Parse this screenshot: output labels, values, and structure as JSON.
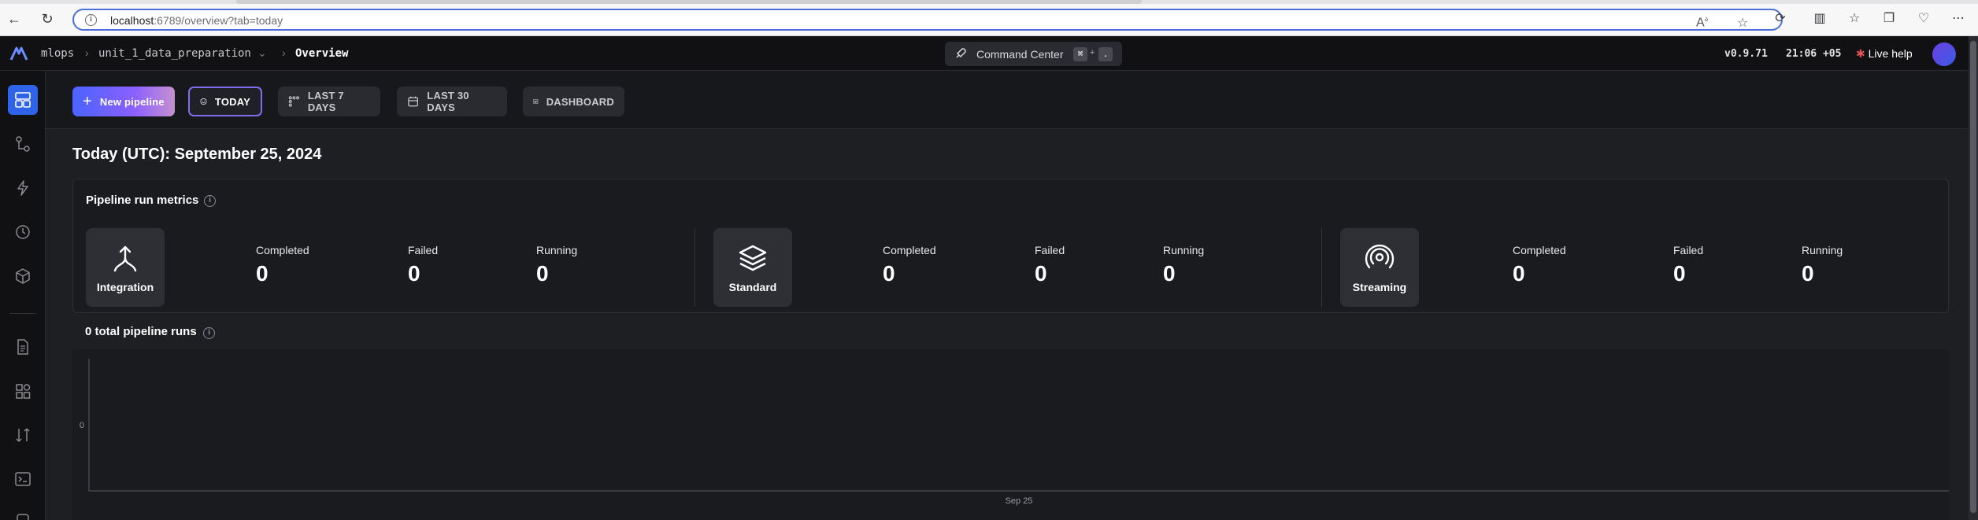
{
  "browser": {
    "url_host": "localhost",
    "url_rest": ":6789/overview?tab=today"
  },
  "header": {
    "brand": "mlops",
    "project": "unit_1_data_preparation",
    "page": "Overview",
    "command_center": "Command Center",
    "shortcut_keys": [
      "⌘",
      "+",
      "."
    ],
    "version": "v0.9.71",
    "time": "21:06 +05",
    "live_help": "Live help"
  },
  "toolbar": {
    "new_pipeline": "New pipeline",
    "tabs": [
      {
        "label": "TODAY",
        "active": true,
        "icon": "smiley-icon"
      },
      {
        "label": "LAST 7 DAYS",
        "active": false,
        "icon": "calendar-grid-icon"
      },
      {
        "label": "LAST 30 DAYS",
        "active": false,
        "icon": "calendar-icon"
      },
      {
        "label": "DASHBOARD",
        "active": false,
        "icon": "dashboard-icon"
      }
    ]
  },
  "page_title": "Today (UTC): September 25, 2024",
  "metrics": {
    "title": "Pipeline run metrics",
    "groups": [
      {
        "type": "Integration",
        "icon": "merge-icon",
        "completed": "0",
        "failed": "0",
        "running": "0"
      },
      {
        "type": "Standard",
        "icon": "layers-icon",
        "completed": "0",
        "failed": "0",
        "running": "0"
      },
      {
        "type": "Streaming",
        "icon": "broadcast-icon",
        "completed": "0",
        "failed": "0",
        "running": "0"
      }
    ],
    "labels": {
      "completed": "Completed",
      "failed": "Failed",
      "running": "Running"
    }
  },
  "runs": {
    "title": "0 total pipeline runs"
  },
  "chart_data": {
    "type": "bar",
    "categories": [
      "Sep 25"
    ],
    "values": [
      0
    ],
    "title": "",
    "xlabel": "",
    "ylabel": "",
    "yticks": [
      "0"
    ],
    "grid": false
  },
  "colors": {
    "accent": "#2f63e8",
    "today_border": "#7f6df0",
    "background": "#1e1f23"
  }
}
